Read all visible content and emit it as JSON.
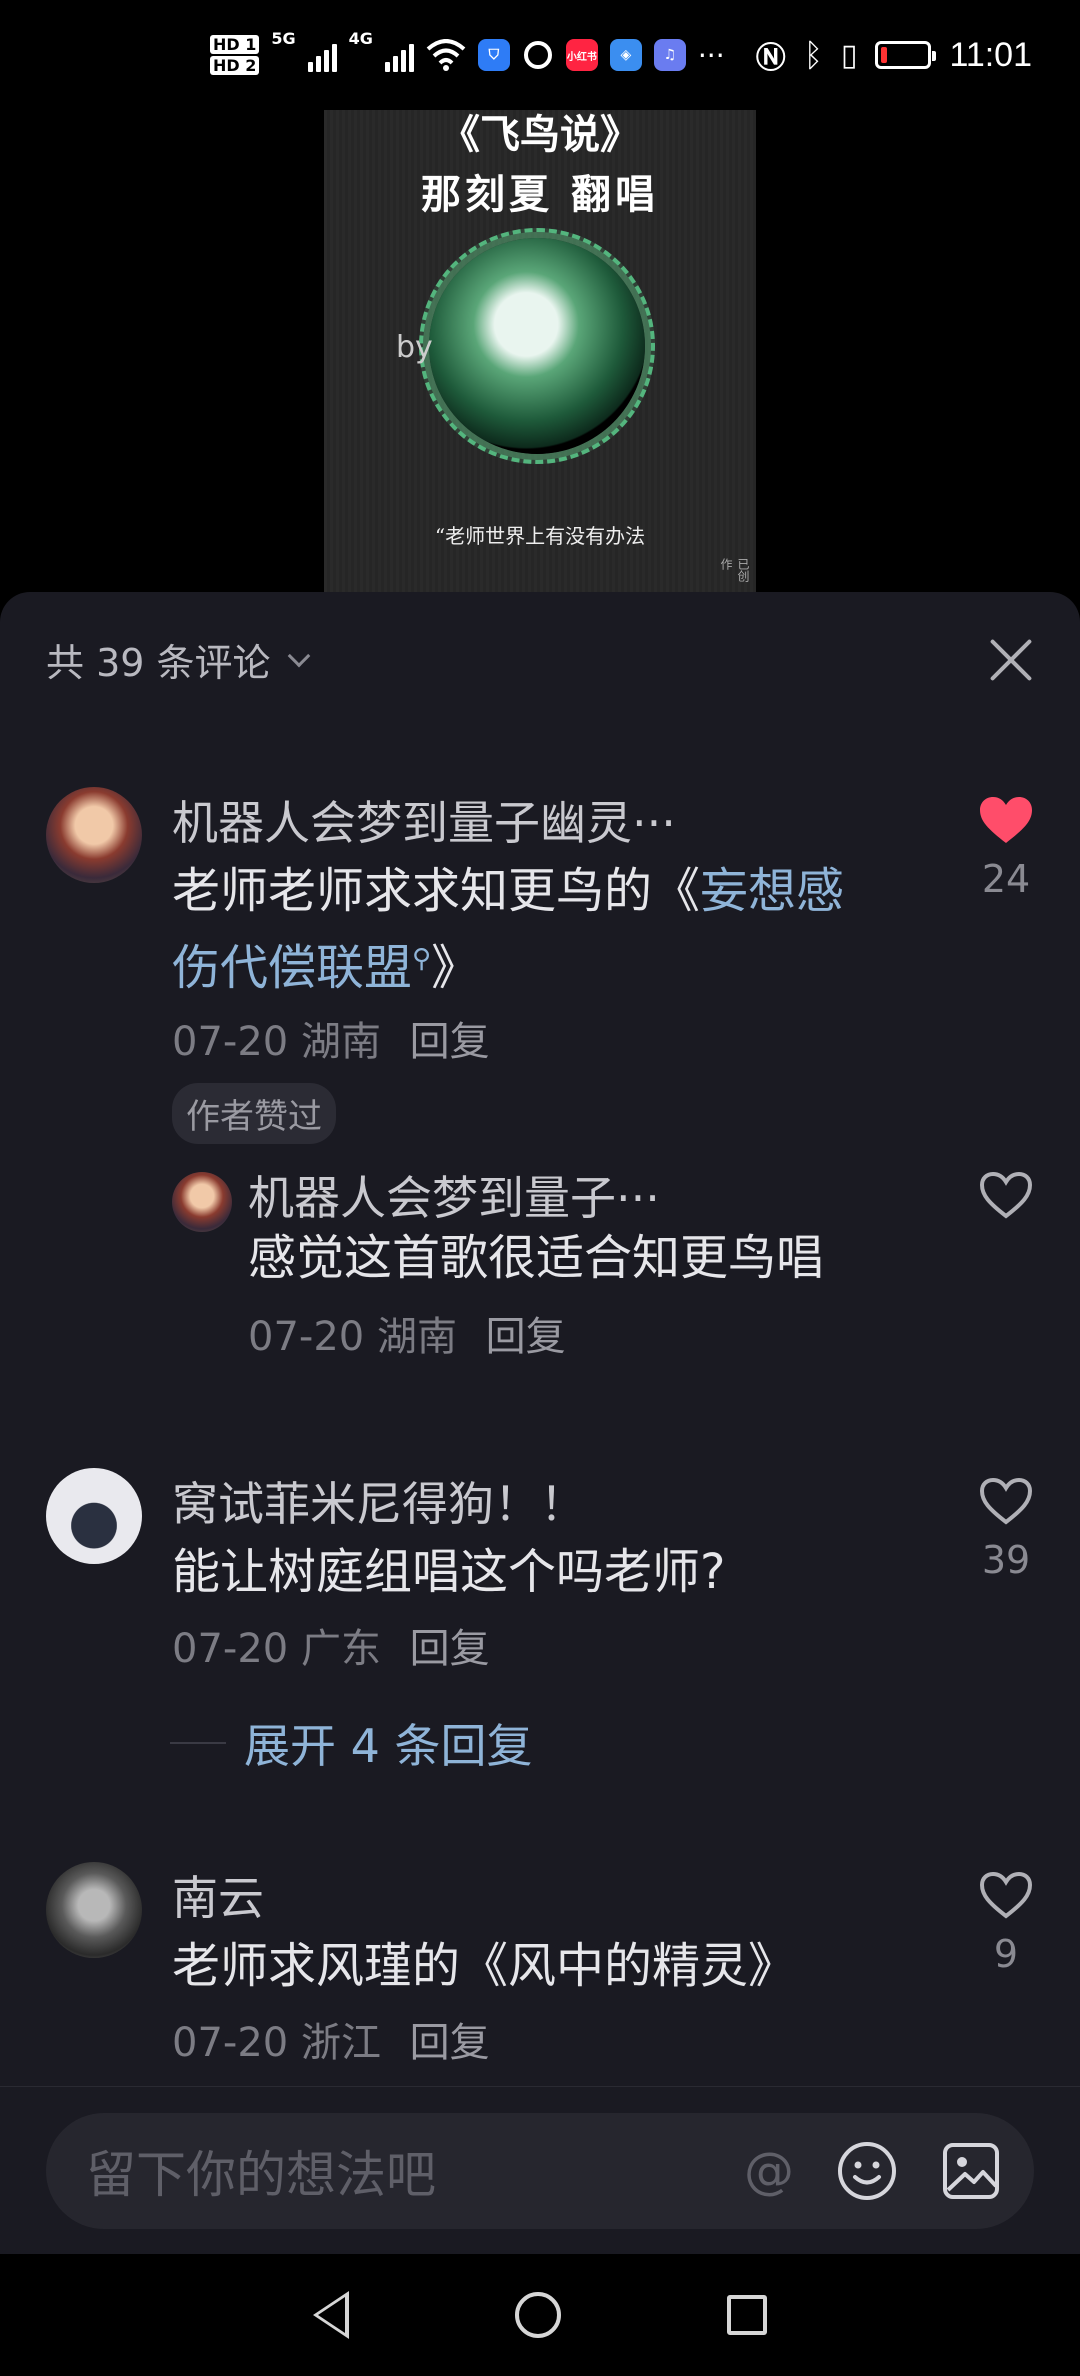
{
  "status_bar": {
    "sim1": "HD 1",
    "sim2": "HD 2",
    "net1": "5G",
    "net2": "4G",
    "app_badge": "小红书",
    "more": "···",
    "time": "11:01",
    "battery_color": "#ff3333"
  },
  "video_thumb": {
    "title": "《飞鸟说》",
    "subtitle": "那刻夏 翻唱",
    "by": "by",
    "lyric": "“老师世界上有没有办法",
    "side_text": "已创作"
  },
  "sheet": {
    "count_label": "共 39 条评论",
    "close_icon": "close-icon"
  },
  "comments": [
    {
      "username": "机器人会梦到量子幽灵···",
      "text_prefix": "老师老师求求知更鸟的《",
      "text_link": "妄想感伤代偿联盟",
      "text_suffix": "》",
      "date": "07-20",
      "location": "湖南",
      "reply": "回复",
      "tag": "作者赞过",
      "likes": "24",
      "liked": true
    },
    {
      "username": "机器人会梦到量子···",
      "text": "感觉这首歌很适合知更鸟唱",
      "date": "07-20",
      "location": "湖南",
      "reply": "回复",
      "liked": false
    },
    {
      "username": "窝试菲米尼得狗！！",
      "text": "能让树庭组唱这个吗老师?",
      "date": "07-20",
      "location": "广东",
      "reply": "回复",
      "likes": "39",
      "liked": false,
      "expand": "展开 4 条回复"
    },
    {
      "username": "南云",
      "text": "老师求风瑾的《风中的精灵》",
      "date": "07-20",
      "location": "浙江",
      "reply": "回复",
      "likes": "9",
      "liked": false
    }
  ],
  "input": {
    "placeholder": "留下你的想法吧",
    "at_symbol": "@"
  },
  "colors": {
    "sheet_bg": "#1a1a22",
    "link": "#8fb4d8",
    "liked_heart": "#ff4d6a"
  }
}
